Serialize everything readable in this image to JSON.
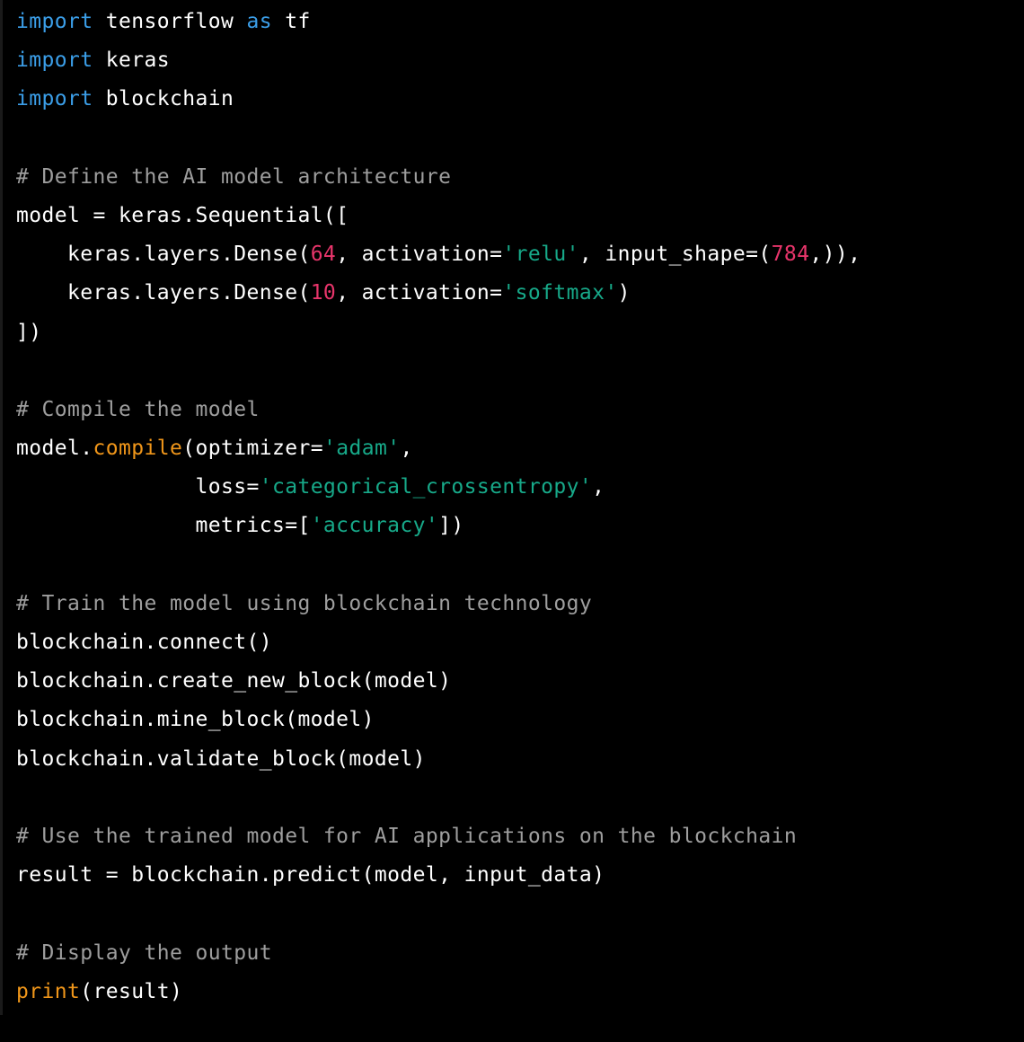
{
  "colors": {
    "background": "#000000",
    "plain": "#ffffff",
    "keyword": "#3b9ee8",
    "comment": "#9e9e9e",
    "string": "#17a989",
    "number": "#e8356b",
    "builtin": "#f0961a"
  },
  "code": {
    "lines": [
      [
        {
          "t": "import",
          "k": "keyword"
        },
        {
          "t": " tensorflow ",
          "k": "plain"
        },
        {
          "t": "as",
          "k": "keyword"
        },
        {
          "t": " tf",
          "k": "plain"
        }
      ],
      [
        {
          "t": "import",
          "k": "keyword"
        },
        {
          "t": " keras",
          "k": "plain"
        }
      ],
      [
        {
          "t": "import",
          "k": "keyword"
        },
        {
          "t": " blockchain",
          "k": "plain"
        }
      ],
      [],
      [
        {
          "t": "# Define the AI model architecture",
          "k": "comment"
        }
      ],
      [
        {
          "t": "model = keras.Sequential([",
          "k": "plain"
        }
      ],
      [
        {
          "t": "    keras.layers.Dense(",
          "k": "plain"
        },
        {
          "t": "64",
          "k": "number"
        },
        {
          "t": ", activation=",
          "k": "plain"
        },
        {
          "t": "'relu'",
          "k": "string"
        },
        {
          "t": ", input_shape=(",
          "k": "plain"
        },
        {
          "t": "784",
          "k": "number"
        },
        {
          "t": ",)),",
          "k": "plain"
        }
      ],
      [
        {
          "t": "    keras.layers.Dense(",
          "k": "plain"
        },
        {
          "t": "10",
          "k": "number"
        },
        {
          "t": ", activation=",
          "k": "plain"
        },
        {
          "t": "'softmax'",
          "k": "string"
        },
        {
          "t": ")",
          "k": "plain"
        }
      ],
      [
        {
          "t": "])",
          "k": "plain"
        }
      ],
      [],
      [
        {
          "t": "# Compile the model",
          "k": "comment"
        }
      ],
      [
        {
          "t": "model.",
          "k": "plain"
        },
        {
          "t": "compile",
          "k": "builtin"
        },
        {
          "t": "(optimizer=",
          "k": "plain"
        },
        {
          "t": "'adam'",
          "k": "string"
        },
        {
          "t": ",",
          "k": "plain"
        }
      ],
      [
        {
          "t": "              loss=",
          "k": "plain"
        },
        {
          "t": "'categorical_crossentropy'",
          "k": "string"
        },
        {
          "t": ",",
          "k": "plain"
        }
      ],
      [
        {
          "t": "              metrics=[",
          "k": "plain"
        },
        {
          "t": "'accuracy'",
          "k": "string"
        },
        {
          "t": "])",
          "k": "plain"
        }
      ],
      [],
      [
        {
          "t": "# Train the model using blockchain technology",
          "k": "comment"
        }
      ],
      [
        {
          "t": "blockchain.connect()",
          "k": "plain"
        }
      ],
      [
        {
          "t": "blockchain.create_new_block(model)",
          "k": "plain"
        }
      ],
      [
        {
          "t": "blockchain.mine_block(model)",
          "k": "plain"
        }
      ],
      [
        {
          "t": "blockchain.validate_block(model)",
          "k": "plain"
        }
      ],
      [],
      [
        {
          "t": "# Use the trained model for AI applications on the blockchain",
          "k": "comment"
        }
      ],
      [
        {
          "t": "result = blockchain.predict(model, input_data)",
          "k": "plain"
        }
      ],
      [],
      [
        {
          "t": "# Display the output",
          "k": "comment"
        }
      ],
      [
        {
          "t": "print",
          "k": "builtin"
        },
        {
          "t": "(result)",
          "k": "plain"
        }
      ]
    ]
  }
}
